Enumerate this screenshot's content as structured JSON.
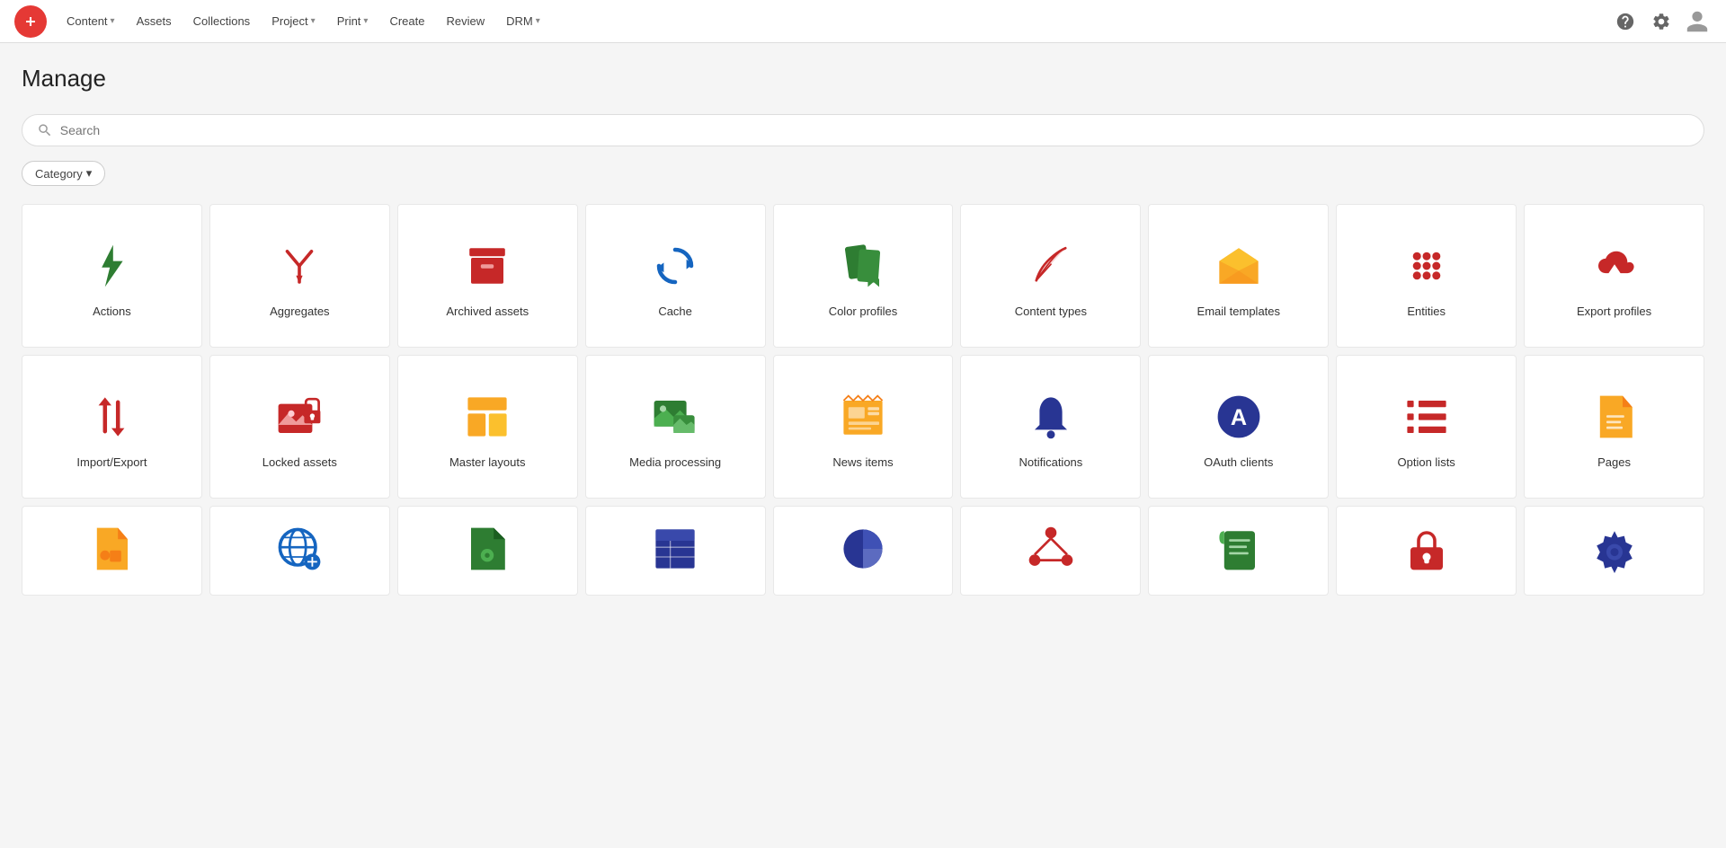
{
  "navbar": {
    "logo_alt": "App logo",
    "nav_items": [
      {
        "label": "Content",
        "has_dropdown": true
      },
      {
        "label": "Assets",
        "has_dropdown": false
      },
      {
        "label": "Collections",
        "has_dropdown": false
      },
      {
        "label": "Project",
        "has_dropdown": true
      },
      {
        "label": "Print",
        "has_dropdown": true
      },
      {
        "label": "Create",
        "has_dropdown": false
      },
      {
        "label": "Review",
        "has_dropdown": false
      },
      {
        "label": "DRM",
        "has_dropdown": true
      }
    ]
  },
  "page": {
    "title": "Manage"
  },
  "search": {
    "placeholder": "Search"
  },
  "category_button": {
    "label": "Category"
  },
  "cards_row1": [
    {
      "id": "actions",
      "label": "Actions",
      "icon_type": "lightning",
      "color": "#2e7d32"
    },
    {
      "id": "aggregates",
      "label": "Aggregates",
      "icon_type": "merge-arrows",
      "color": "#c62828"
    },
    {
      "id": "archived-assets",
      "label": "Archived assets",
      "icon_type": "archive-box",
      "color": "#c62828"
    },
    {
      "id": "cache",
      "label": "Cache",
      "icon_type": "refresh",
      "color": "#1565c0"
    },
    {
      "id": "color-profiles",
      "label": "Color profiles",
      "icon_type": "bookmark-tags",
      "color": "#2e7d32"
    },
    {
      "id": "content-types",
      "label": "Content types",
      "icon_type": "feather",
      "color": "#c62828"
    },
    {
      "id": "email-templates",
      "label": "Email templates",
      "icon_type": "envelope-open",
      "color": "#f9a825"
    },
    {
      "id": "entities",
      "label": "Entities",
      "icon_type": "grid-dots",
      "color": "#c62828"
    },
    {
      "id": "export-profiles",
      "label": "Export profiles",
      "icon_type": "cloud-download",
      "color": "#c62828"
    }
  ],
  "cards_row2": [
    {
      "id": "import-export",
      "label": "Import/Export",
      "icon_type": "arrows-updown",
      "color": "#c62828"
    },
    {
      "id": "locked-assets",
      "label": "Locked assets",
      "icon_type": "image-lock",
      "color": "#c62828"
    },
    {
      "id": "master-layouts",
      "label": "Master layouts",
      "icon_type": "layout",
      "color": "#f9a825"
    },
    {
      "id": "media-processing",
      "label": "Media processing",
      "icon_type": "media-image",
      "color": "#2e7d32"
    },
    {
      "id": "news-items",
      "label": "News items",
      "icon_type": "news",
      "color": "#f9a825"
    },
    {
      "id": "notifications",
      "label": "Notifications",
      "icon_type": "bell",
      "color": "#283593"
    },
    {
      "id": "oauth-clients",
      "label": "OAuth clients",
      "icon_type": "oauth-a",
      "color": "#283593"
    },
    {
      "id": "option-lists",
      "label": "Option lists",
      "icon_type": "list-options",
      "color": "#c62828"
    },
    {
      "id": "pages",
      "label": "Pages",
      "icon_type": "document",
      "color": "#f9a825"
    }
  ],
  "cards_row3": [
    {
      "id": "card-r3-1",
      "label": "",
      "icon_type": "doc-puzzle",
      "color": "#f9a825"
    },
    {
      "id": "card-r3-2",
      "label": "",
      "icon_type": "globe-gear",
      "color": "#1565c0"
    },
    {
      "id": "card-r3-3",
      "label": "",
      "icon_type": "doc-gear",
      "color": "#2e7d32"
    },
    {
      "id": "card-r3-4",
      "label": "",
      "icon_type": "table-list",
      "color": "#283593"
    },
    {
      "id": "card-r3-5",
      "label": "",
      "icon_type": "pie-chart",
      "color": "#283593"
    },
    {
      "id": "card-r3-6",
      "label": "",
      "icon_type": "network",
      "color": "#c62828"
    },
    {
      "id": "card-r3-7",
      "label": "",
      "icon_type": "scroll-doc",
      "color": "#2e7d32"
    },
    {
      "id": "card-r3-8",
      "label": "",
      "icon_type": "padlock-red",
      "color": "#c62828"
    },
    {
      "id": "card-r3-9",
      "label": "",
      "icon_type": "gear-blue",
      "color": "#283593"
    }
  ]
}
